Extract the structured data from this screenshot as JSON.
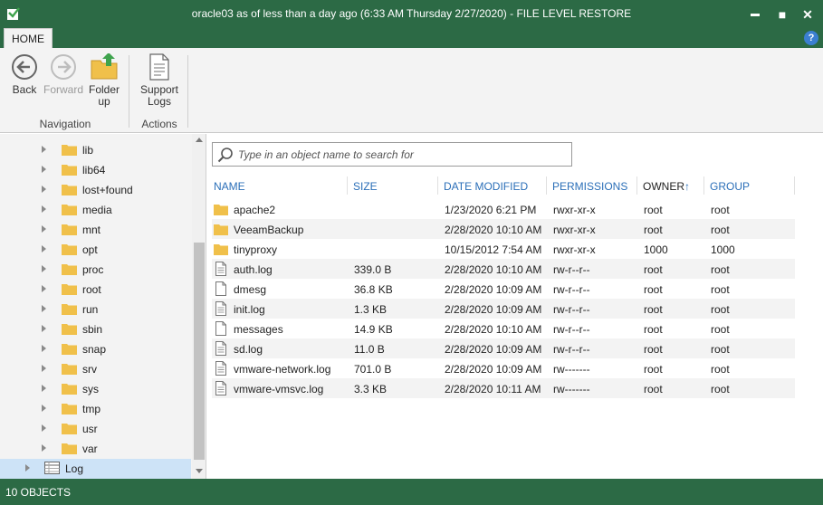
{
  "window": {
    "title": "oracle03 as of less than a day ago (6:33 AM Thursday 2/27/2020) - FILE LEVEL RESTORE",
    "minimize_glyph": "▬",
    "maximize_glyph": "■",
    "close_glyph": "✕"
  },
  "ribbon": {
    "tab_home": "HOME",
    "help_glyph": "?",
    "back_label": "Back",
    "forward_label": "Forward",
    "folder_up_label_1": "Folder",
    "folder_up_label_2": "up",
    "support_logs_label_1": "Support",
    "support_logs_label_2": "Logs",
    "group_navigation": "Navigation",
    "group_actions": "Actions"
  },
  "tree": {
    "items": [
      {
        "label": "lib"
      },
      {
        "label": "lib64"
      },
      {
        "label": "lost+found"
      },
      {
        "label": "media"
      },
      {
        "label": "mnt"
      },
      {
        "label": "opt"
      },
      {
        "label": "proc"
      },
      {
        "label": "root"
      },
      {
        "label": "run"
      },
      {
        "label": "sbin"
      },
      {
        "label": "snap"
      },
      {
        "label": "srv"
      },
      {
        "label": "sys"
      },
      {
        "label": "tmp"
      },
      {
        "label": "usr"
      },
      {
        "label": "var"
      }
    ],
    "log_item": {
      "label": "Log"
    }
  },
  "search": {
    "placeholder": "Type in an object name to search for"
  },
  "columns": {
    "name": "NAME",
    "size": "SIZE",
    "date": "DATE MODIFIED",
    "permissions": "PERMISSIONS",
    "owner": "OWNER",
    "owner_sort_glyph": "↑",
    "group": "GROUP"
  },
  "files": [
    {
      "name": "apache2",
      "size": "",
      "date": "1/23/2020 6:21 PM",
      "permissions": "rwxr-xr-x",
      "owner": "root",
      "group": "root",
      "icon": "folder-icon"
    },
    {
      "name": "VeeamBackup",
      "size": "",
      "date": "2/28/2020 10:10 AM",
      "permissions": "rwxr-xr-x",
      "owner": "root",
      "group": "root",
      "icon": "folder-icon"
    },
    {
      "name": "tinyproxy",
      "size": "",
      "date": "10/15/2012 7:54 AM",
      "permissions": "rwxr-xr-x",
      "owner": "1000",
      "group": "1000",
      "icon": "folder-icon"
    },
    {
      "name": "auth.log",
      "size": "339.0 B",
      "date": "2/28/2020 10:10 AM",
      "permissions": "rw-r--r--",
      "owner": "root",
      "group": "root",
      "icon": "log-file-icon"
    },
    {
      "name": "dmesg",
      "size": "36.8 KB",
      "date": "2/28/2020 10:09 AM",
      "permissions": "rw-r--r--",
      "owner": "root",
      "group": "root",
      "icon": "file-icon"
    },
    {
      "name": "init.log",
      "size": "1.3 KB",
      "date": "2/28/2020 10:09 AM",
      "permissions": "rw-r--r--",
      "owner": "root",
      "group": "root",
      "icon": "log-file-icon"
    },
    {
      "name": "messages",
      "size": "14.9 KB",
      "date": "2/28/2020 10:10 AM",
      "permissions": "rw-r--r--",
      "owner": "root",
      "group": "root",
      "icon": "file-icon"
    },
    {
      "name": "sd.log",
      "size": "11.0 B",
      "date": "2/28/2020 10:09 AM",
      "permissions": "rw-r--r--",
      "owner": "root",
      "group": "root",
      "icon": "log-file-icon"
    },
    {
      "name": "vmware-network.log",
      "size": "701.0 B",
      "date": "2/28/2020 10:09 AM",
      "permissions": "rw-------",
      "owner": "root",
      "group": "root",
      "icon": "log-file-icon"
    },
    {
      "name": "vmware-vmsvc.log",
      "size": "3.3 KB",
      "date": "2/28/2020 10:11 AM",
      "permissions": "rw-------",
      "owner": "root",
      "group": "root",
      "icon": "log-file-icon"
    }
  ],
  "status": {
    "text": "10 OBJECTS"
  },
  "colors": {
    "title_bar": "#2c6a45",
    "accent_link": "#2b6fb8",
    "selection": "#cde3f7",
    "folder": "#f0c04a"
  }
}
